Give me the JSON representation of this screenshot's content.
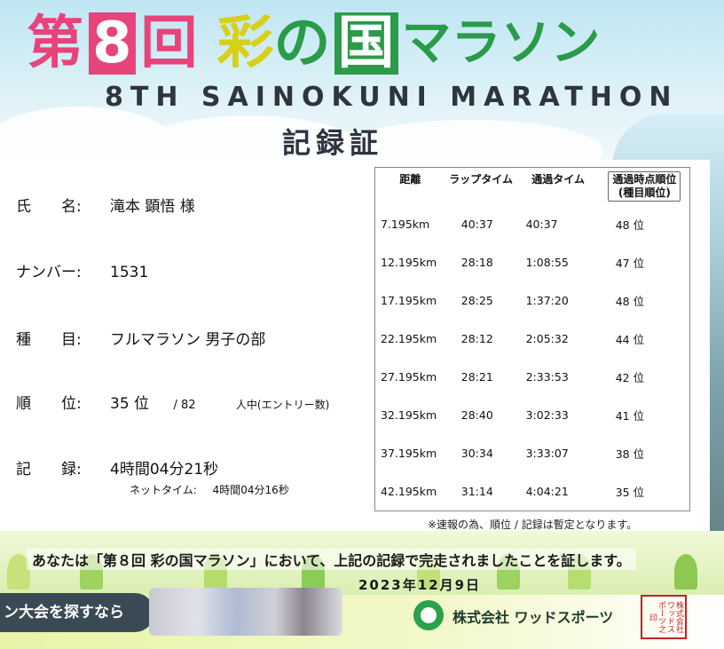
{
  "header": {
    "title_dai": "第",
    "title_num": "8",
    "title_kai": "回",
    "title_sai": "彩",
    "title_no": "の",
    "title_kuni": "国",
    "title_marathon": "マラソン",
    "subtitle": "8TH SAINOKUNI MARATHON",
    "certificate": "記録証"
  },
  "fields": {
    "name_label": "氏　　名:",
    "name_value": "滝本 顕悟 様",
    "number_label": "ナンバー:",
    "number_value": "1531",
    "event_label": "種　　目:",
    "event_value": "フルマラソン 男子の部",
    "rank_label": "順　　位:",
    "rank_value": "35 位",
    "rank_total": "/ 82",
    "rank_suffix": "人中(エントリー数)",
    "record_label": "記　　録:",
    "record_value": "4時間04分21秒",
    "net_label": "ネットタイム:",
    "net_value": "4時間04分16秒"
  },
  "splits": {
    "headers": [
      "距離",
      "ラップタイム",
      "通過タイム",
      "通過時点順位",
      "(種目順位)"
    ],
    "rows": [
      [
        "7.195km",
        "40:37",
        "40:37",
        "48 位"
      ],
      [
        "12.195km",
        "28:18",
        "1:08:55",
        "47 位"
      ],
      [
        "17.195km",
        "28:25",
        "1:37:20",
        "48 位"
      ],
      [
        "22.195km",
        "28:12",
        "2:05:32",
        "44 位"
      ],
      [
        "27.195km",
        "28:21",
        "2:33:53",
        "42 位"
      ],
      [
        "32.195km",
        "28:40",
        "3:02:33",
        "41 位"
      ],
      [
        "37.195km",
        "30:34",
        "3:33:07",
        "38 位"
      ],
      [
        "42.195km",
        "31:14",
        "4:04:21",
        "35 位"
      ]
    ]
  },
  "note": "※速報の為、順位 / 記録は暫定となります。",
  "statement": "あなたは「第８回 彩の国マラソン」において、上記の記録で完走されましたことを証します。",
  "date": "2023年12月9日",
  "footer": {
    "banner": "ン大会を探すなら",
    "company": "株式会社 ワッドスポーツ",
    "seal": "株式会社ワッドスポーツ之印"
  },
  "colors": {
    "pink": "#e8437a",
    "green": "#2a9b49",
    "yellow": "#d8d017",
    "seal_red": "#c3222a"
  }
}
